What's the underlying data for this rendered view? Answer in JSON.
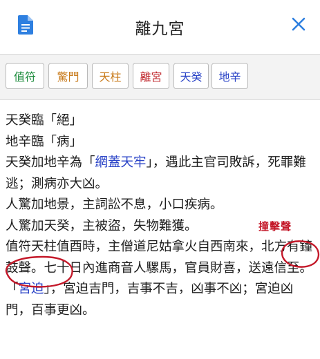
{
  "header": {
    "title": "離九宮"
  },
  "tabs": [
    {
      "label": "值符",
      "color": "#1a8a3a"
    },
    {
      "label": "驚門",
      "color": "#c87a1a"
    },
    {
      "label": "天柱",
      "color": "#c87a1a"
    },
    {
      "label": "離宮",
      "color": "#c0282d"
    },
    {
      "label": "天癸",
      "color": "#2a43c7"
    },
    {
      "label": "地辛",
      "color": "#2a43c7"
    }
  ],
  "content": {
    "lines": [
      "天癸臨「絕」",
      "地辛臨「病」"
    ],
    "p3": {
      "pre": "天癸加地辛為「",
      "link": "網蓋天牢",
      "post": "」，遇此主官司敗訴，死罪難逃；測病亦大凶。"
    },
    "p4": "人驚加地景，主詞訟不息，小口疾病。",
    "p5": "人驚加天癸，主被盜，失物難獲。",
    "p6": "值符天柱值酉時，主僧道尼姑拿火自西南來，北方有鐘鼓聲。七十日內進商音人騾馬，官員財喜，送遠信至。",
    "p7": {
      "pre": "「",
      "link": "宮迫",
      "post": "」，宮迫吉門，吉事不吉，凶事不凶；宮迫凶門，百事更凶。"
    }
  },
  "annotation": {
    "text": "撞擊聲",
    "color": "#c4192a"
  }
}
